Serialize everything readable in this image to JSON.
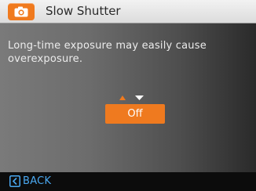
{
  "header": {
    "icon": "camera-icon",
    "title": "Slow Shutter"
  },
  "message": {
    "text": "Long-time exposure may easily cause overexposure."
  },
  "selector": {
    "up_icon": "up-arrow-icon",
    "down_icon": "down-arrow-icon",
    "value": "Off"
  },
  "footer": {
    "back_icon": "back-chevron-icon",
    "back_label": "BACK"
  },
  "colors": {
    "accent": "#ef7a1f",
    "back_text": "#4aa8f0"
  }
}
